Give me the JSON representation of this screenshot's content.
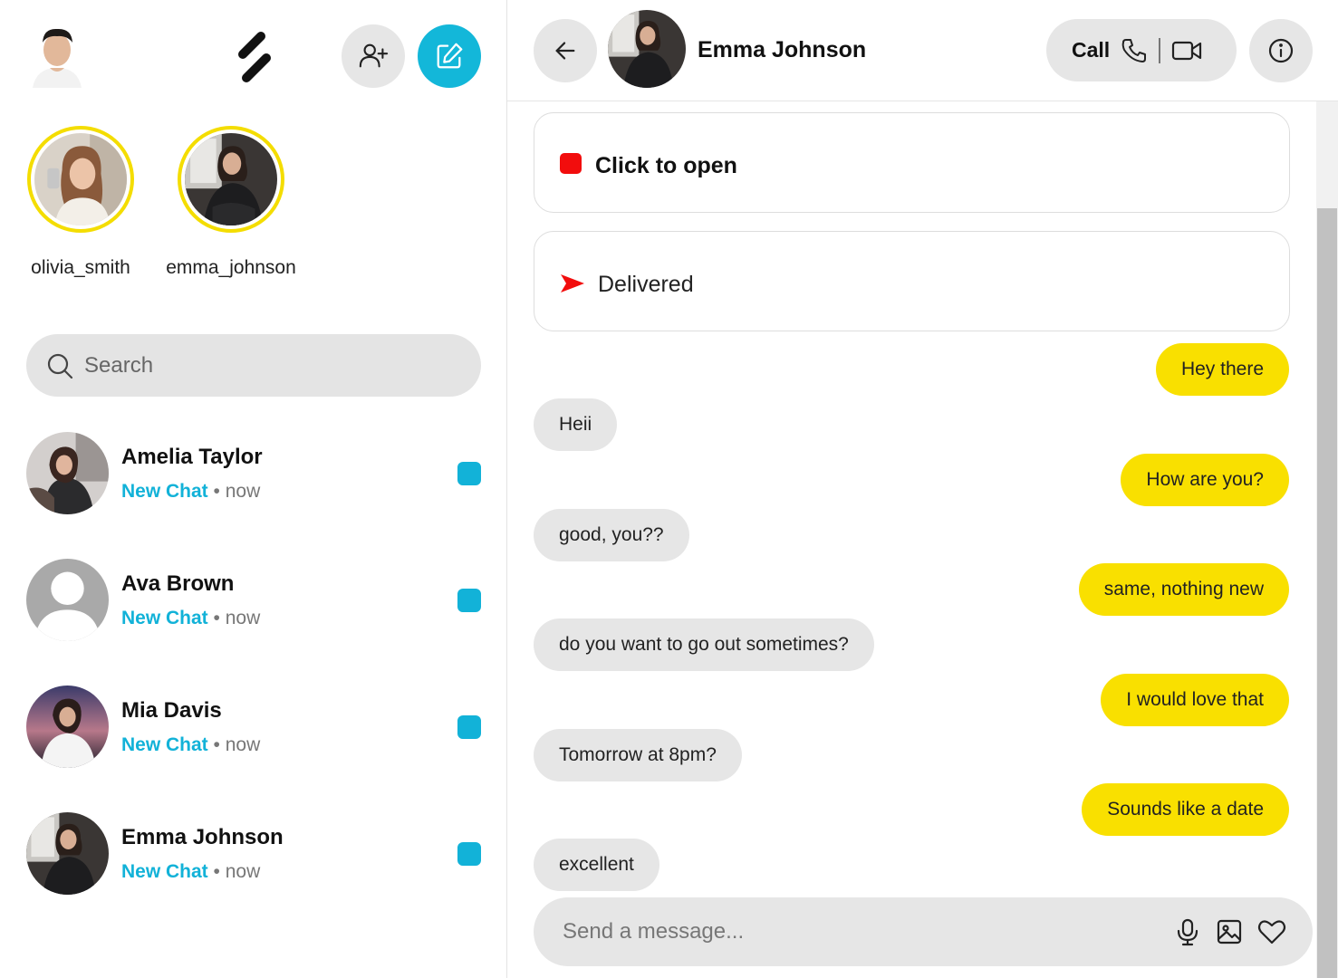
{
  "stories": [
    {
      "username": "olivia_smith"
    },
    {
      "username": "emma_johnson"
    }
  ],
  "search": {
    "placeholder": "Search"
  },
  "chats": [
    {
      "name": "Amelia Taylor",
      "status": "New Chat",
      "time": "now"
    },
    {
      "name": "Ava Brown",
      "status": "New Chat",
      "time": "now"
    },
    {
      "name": "Mia Davis",
      "status": "New Chat",
      "time": "now"
    },
    {
      "name": "Emma Johnson",
      "status": "New Chat",
      "time": "now"
    }
  ],
  "conversation": {
    "contact_name": "Emma Johnson",
    "call_label": "Call",
    "open_card": "Click to open",
    "delivered_card": "Delivered",
    "messages": [
      {
        "from": "me",
        "text": "Hey there"
      },
      {
        "from": "them",
        "text": "Heii"
      },
      {
        "from": "me",
        "text": "How are you?"
      },
      {
        "from": "them",
        "text": "good, you??"
      },
      {
        "from": "me",
        "text": "same, nothing new"
      },
      {
        "from": "them",
        "text": "do you want to go out sometimes?"
      },
      {
        "from": "me",
        "text": "I would love that"
      },
      {
        "from": "them",
        "text": "Tomorrow at 8pm?"
      },
      {
        "from": "me",
        "text": "Sounds like a date"
      },
      {
        "from": "them",
        "text": "excellent"
      }
    ],
    "composer_placeholder": "Send a message..."
  },
  "icons": {
    "add_friend": "add-user-icon",
    "new_chat": "edit-icon",
    "back": "arrow-left-icon",
    "phone": "phone-icon",
    "video": "video-icon",
    "info": "info-icon",
    "mic": "microphone-icon",
    "image": "image-icon",
    "heart": "heart-icon"
  },
  "colors": {
    "accent_blue": "#12b2d8",
    "story_ring": "#f4dd00",
    "outgoing_bubble": "#f9e000",
    "incoming_bubble": "#e6e6e6",
    "unread_red": "#f20d0d"
  }
}
